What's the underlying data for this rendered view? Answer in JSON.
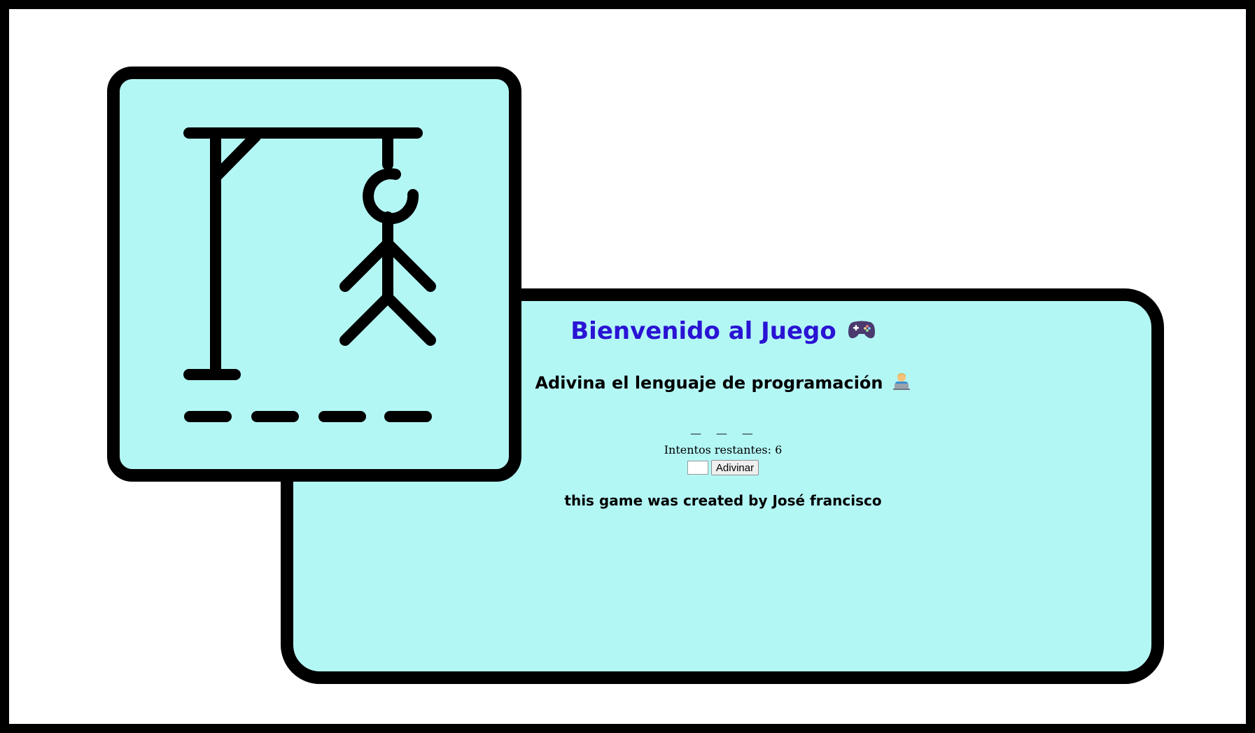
{
  "header": {
    "title": "Bienvenido al Juego",
    "title_icon": "gamepad-icon",
    "subtitle": "Adivina el lenguaje de programación",
    "subtitle_icon": "technologist-icon"
  },
  "game": {
    "word_display": "_ _ _",
    "attempts_text": "Intentos restantes: 6",
    "guess_value": "",
    "guess_button_label": "Adivinar"
  },
  "footer": {
    "credit": "this game was created by José francisco"
  },
  "colors": {
    "panel_background": "#b3f7f5",
    "title": "#2a13d4",
    "border": "#000000"
  }
}
